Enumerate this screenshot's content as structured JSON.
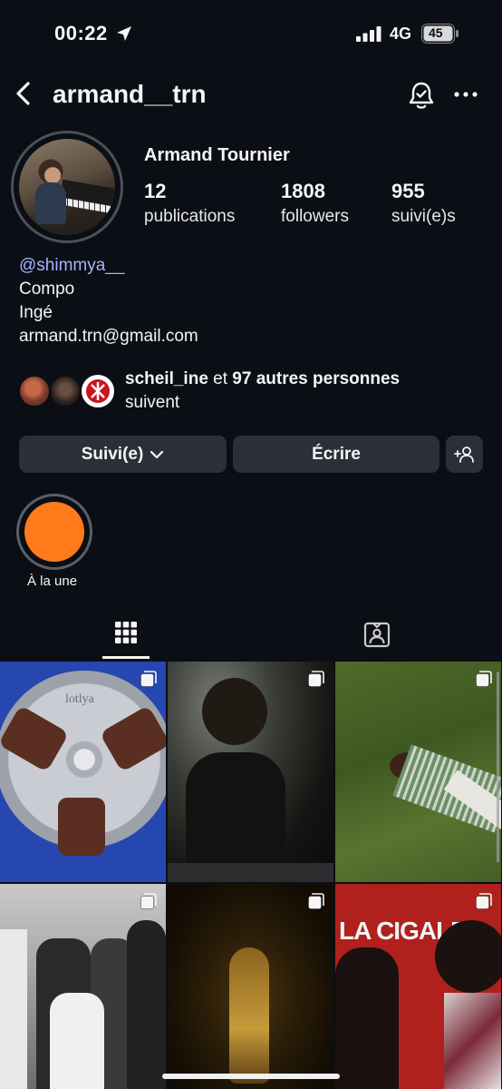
{
  "status_bar": {
    "time": "00:22",
    "network": "4G",
    "battery": "45"
  },
  "header": {
    "username": "armand__trn",
    "back_icon": "chevron-left-icon",
    "bell_icon": "bell-check-icon",
    "more_icon": "more-horizontal-icon"
  },
  "profile": {
    "full_name": "Armand Tournier",
    "stats": [
      {
        "value": "12",
        "label": "publications"
      },
      {
        "value": "1808",
        "label": "followers"
      },
      {
        "value": "955",
        "label": "suivi(e)s"
      }
    ],
    "bio_link": "@shimmya__",
    "bio_lines": [
      "Compo",
      "Ingé",
      "armand.trn@gmail.com"
    ]
  },
  "followed_by": {
    "name": "scheil_ine",
    "middle": " et ",
    "others": "97 autres personnes",
    "line2": "suivent"
  },
  "actions": {
    "following": "Suivi(e)",
    "message": "Écrire",
    "add_person_icon": "add-person-icon"
  },
  "highlights": [
    {
      "label": "À la une",
      "color": "#ff7a1a"
    }
  ],
  "tabs": [
    {
      "icon": "grid-icon",
      "active": true
    },
    {
      "icon": "tagged-icon",
      "active": false
    }
  ],
  "posts": [
    {
      "label": "lotlya",
      "multi": true
    },
    {
      "label": "",
      "multi": true
    },
    {
      "label": "",
      "multi": true
    },
    {
      "label": "",
      "multi": true
    },
    {
      "label": "",
      "multi": true
    },
    {
      "label": "LA CIGALE",
      "multi": true
    }
  ]
}
